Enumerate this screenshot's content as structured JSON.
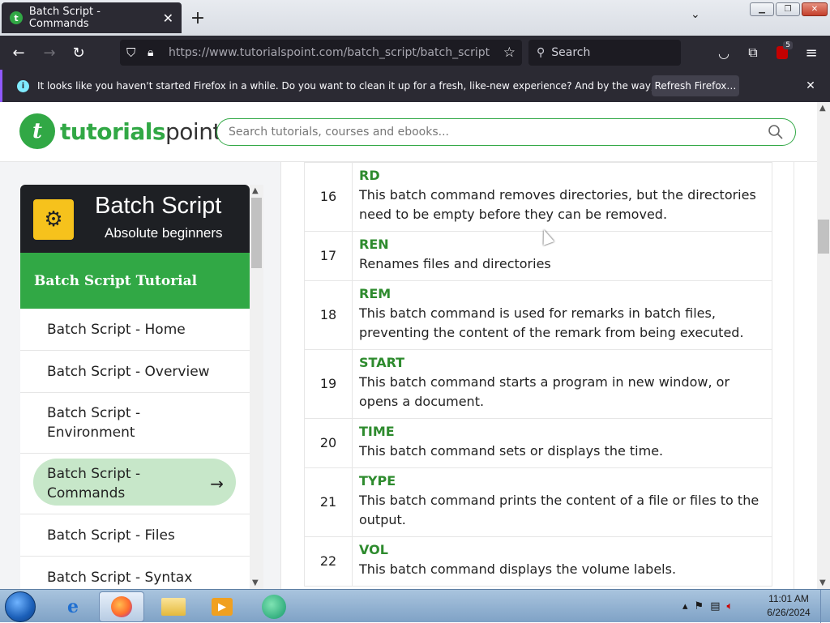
{
  "browser": {
    "tab_title": "Batch Script - Commands",
    "tab_favicon": "t",
    "url_host": "https://www.tutorialspoint.com",
    "url_path": "/batch_script/batch_script_commar",
    "search_placeholder": "Search",
    "extension_badge": "5",
    "notification_text": "It looks like you haven't started Firefox in a while. Do you want to clean it up for a fresh, like-new experience? And by the way, welcome back!",
    "refresh_button": "Refresh Firefox…",
    "accent_color": "#9059ff"
  },
  "site": {
    "logo_part1": "tutorials",
    "logo_part2": "point",
    "search_placeholder": "Search tutorials, courses and ebooks...",
    "brand_color": "#31a845"
  },
  "sidebar": {
    "banner_title": "Batch Script",
    "banner_subtitle": "Absolute beginners",
    "section_title": "Batch Script Tutorial",
    "items": [
      {
        "label": "Batch Script - Home"
      },
      {
        "label": "Batch Script - Overview"
      },
      {
        "label": "Batch Script - Environment"
      },
      {
        "label": "Batch Script - Commands",
        "active": true
      },
      {
        "label": "Batch Script - Files"
      },
      {
        "label": "Batch Script - Syntax"
      }
    ]
  },
  "commands": [
    {
      "num": "16",
      "name": "RD",
      "desc": "This batch command removes directories, but the directories need to be empty before they can be removed."
    },
    {
      "num": "17",
      "name": "REN",
      "desc": "Renames files and directories"
    },
    {
      "num": "18",
      "name": "REM",
      "desc": "This batch command is used for remarks in batch files, preventing the content of the remark from being executed."
    },
    {
      "num": "19",
      "name": "START",
      "desc": "This batch command starts a program in new window, or opens a document."
    },
    {
      "num": "20",
      "name": "TIME",
      "desc": "This batch command sets or displays the time."
    },
    {
      "num": "21",
      "name": "TYPE",
      "desc": "This batch command prints the content of a file or files to the output."
    },
    {
      "num": "22",
      "name": "VOL",
      "desc": "This batch command displays the volume labels."
    }
  ],
  "taskbar": {
    "time": "11:01 AM",
    "date": "6/26/2024"
  }
}
